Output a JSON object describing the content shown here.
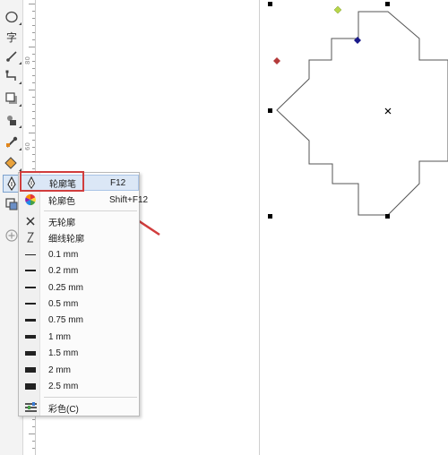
{
  "toolbox": {
    "tools": [
      {
        "name": "ellipse-tool",
        "icon": "ellipse-icon"
      },
      {
        "name": "text-tool",
        "icon": "text-icon",
        "glyph": "字"
      },
      {
        "name": "dimension-tool",
        "icon": "dimension-icon"
      },
      {
        "name": "connector-tool",
        "icon": "connector-icon"
      },
      {
        "name": "shadow-tool",
        "icon": "shadow-icon"
      },
      {
        "name": "transparency-tool",
        "icon": "transparency-icon"
      },
      {
        "name": "eyedropper-tool",
        "icon": "eyedropper-icon"
      },
      {
        "name": "interactive-fill-tool",
        "icon": "fill-icon"
      },
      {
        "name": "outline-tool",
        "icon": "pen-nib-icon"
      },
      {
        "name": "smart-fill-tool",
        "icon": "smart-fill-icon"
      },
      {
        "name": "add-tool",
        "icon": "plus-circle-icon"
      }
    ]
  },
  "ruler": {
    "labels": [
      "80",
      "60"
    ]
  },
  "outline_menu": {
    "items": [
      {
        "label": "轮廓笔",
        "shortcut": "F12",
        "icon": "pen-nib-icon",
        "highlighted": true
      },
      {
        "label": "轮廓色",
        "shortcut": "Shift+F12",
        "icon": "color-wheel-icon"
      },
      {
        "label": "无轮廓",
        "icon": "x-icon"
      },
      {
        "label": "细线轮廓",
        "icon": "hairline-icon"
      },
      {
        "label": "0.1 mm",
        "weight": 0.1
      },
      {
        "label": "0.2 mm",
        "weight": 0.2
      },
      {
        "label": "0.25 mm",
        "weight": 0.25
      },
      {
        "label": "0.5 mm",
        "weight": 0.5
      },
      {
        "label": "0.75 mm",
        "weight": 0.75
      },
      {
        "label": "1 mm",
        "weight": 1
      },
      {
        "label": "1.5 mm",
        "weight": 1.5
      },
      {
        "label": "2 mm",
        "weight": 2
      },
      {
        "label": "2.5 mm",
        "weight": 2.5
      },
      {
        "label": "彩色(C)",
        "icon": "color-bars-icon"
      }
    ]
  },
  "annotation": {
    "box_color": "#d13d3d",
    "arrow_color": "#d13d3d"
  },
  "colors": {
    "selection_handle": "#000000",
    "rotate_handle_green": "#b7d54a",
    "rotate_handle_red": "#b43a3a",
    "node_handle": "#1a1a8a",
    "shape_stroke": "#555555"
  }
}
